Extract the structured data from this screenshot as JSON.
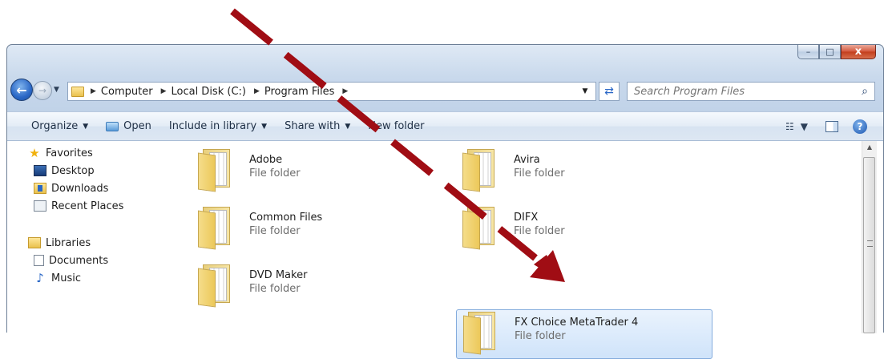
{
  "window": {
    "caption_buttons": {
      "minimize": "–",
      "maximize": "□",
      "close": "x"
    }
  },
  "nav": {
    "back_glyph": "←",
    "forward_glyph": "→",
    "recent_glyph": "▼"
  },
  "address": {
    "crumbs": [
      "Computer",
      "Local Disk (C:)",
      "Program Files"
    ],
    "separator": "▶",
    "dropdown_glyph": "▼",
    "refresh_glyph": "⇄"
  },
  "search": {
    "placeholder": "Search Program Files",
    "icon": "search-icon"
  },
  "commandbar": {
    "organize": "Organize",
    "open": "Open",
    "include_in_library": "Include in library",
    "share_with": "Share with",
    "new_folder": "New folder",
    "dropdown_glyph": "▼",
    "help_glyph": "?"
  },
  "sidebar": {
    "favorites": {
      "label": "Favorites",
      "items": [
        "Desktop",
        "Downloads",
        "Recent Places"
      ]
    },
    "libraries": {
      "label": "Libraries",
      "items": [
        "Documents",
        "Music"
      ]
    }
  },
  "files": [
    {
      "name": "Adobe",
      "type": "File folder"
    },
    {
      "name": "Avira",
      "type": "File folder"
    },
    {
      "name": "Common Files",
      "type": "File folder"
    },
    {
      "name": "DIFX",
      "type": "File folder"
    },
    {
      "name": "DVD Maker",
      "type": "File folder"
    },
    {
      "name": "FX Choice MetaTrader 4",
      "type": "File folder",
      "selected": true
    }
  ],
  "colors": {
    "annotation_arrow": "#a00d14",
    "selection_border": "#84acdd"
  }
}
